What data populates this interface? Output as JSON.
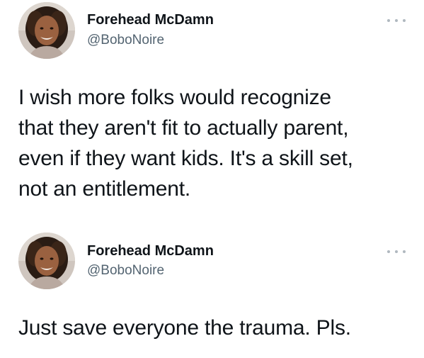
{
  "tweets": [
    {
      "author_name": "Forehead McDamn",
      "handle": "@BoboNoire",
      "avatar_icon": "profile-photo",
      "more_icon": "more-horizontal-icon",
      "text_lines": [
        "I wish more folks would recognize",
        "that they aren't fit to actually parent,",
        "even if they want kids. It's a skill set,",
        "not an entitlement."
      ]
    },
    {
      "author_name": "Forehead McDamn",
      "handle": "@BoboNoire",
      "avatar_icon": "profile-photo",
      "more_icon": "more-horizontal-icon",
      "text_lines": [
        "Just save everyone the trauma. Pls."
      ]
    }
  ],
  "colors": {
    "text": "#0f1419",
    "secondary": "#536471",
    "more_dots": "#b0b8bf",
    "background": "#ffffff"
  }
}
